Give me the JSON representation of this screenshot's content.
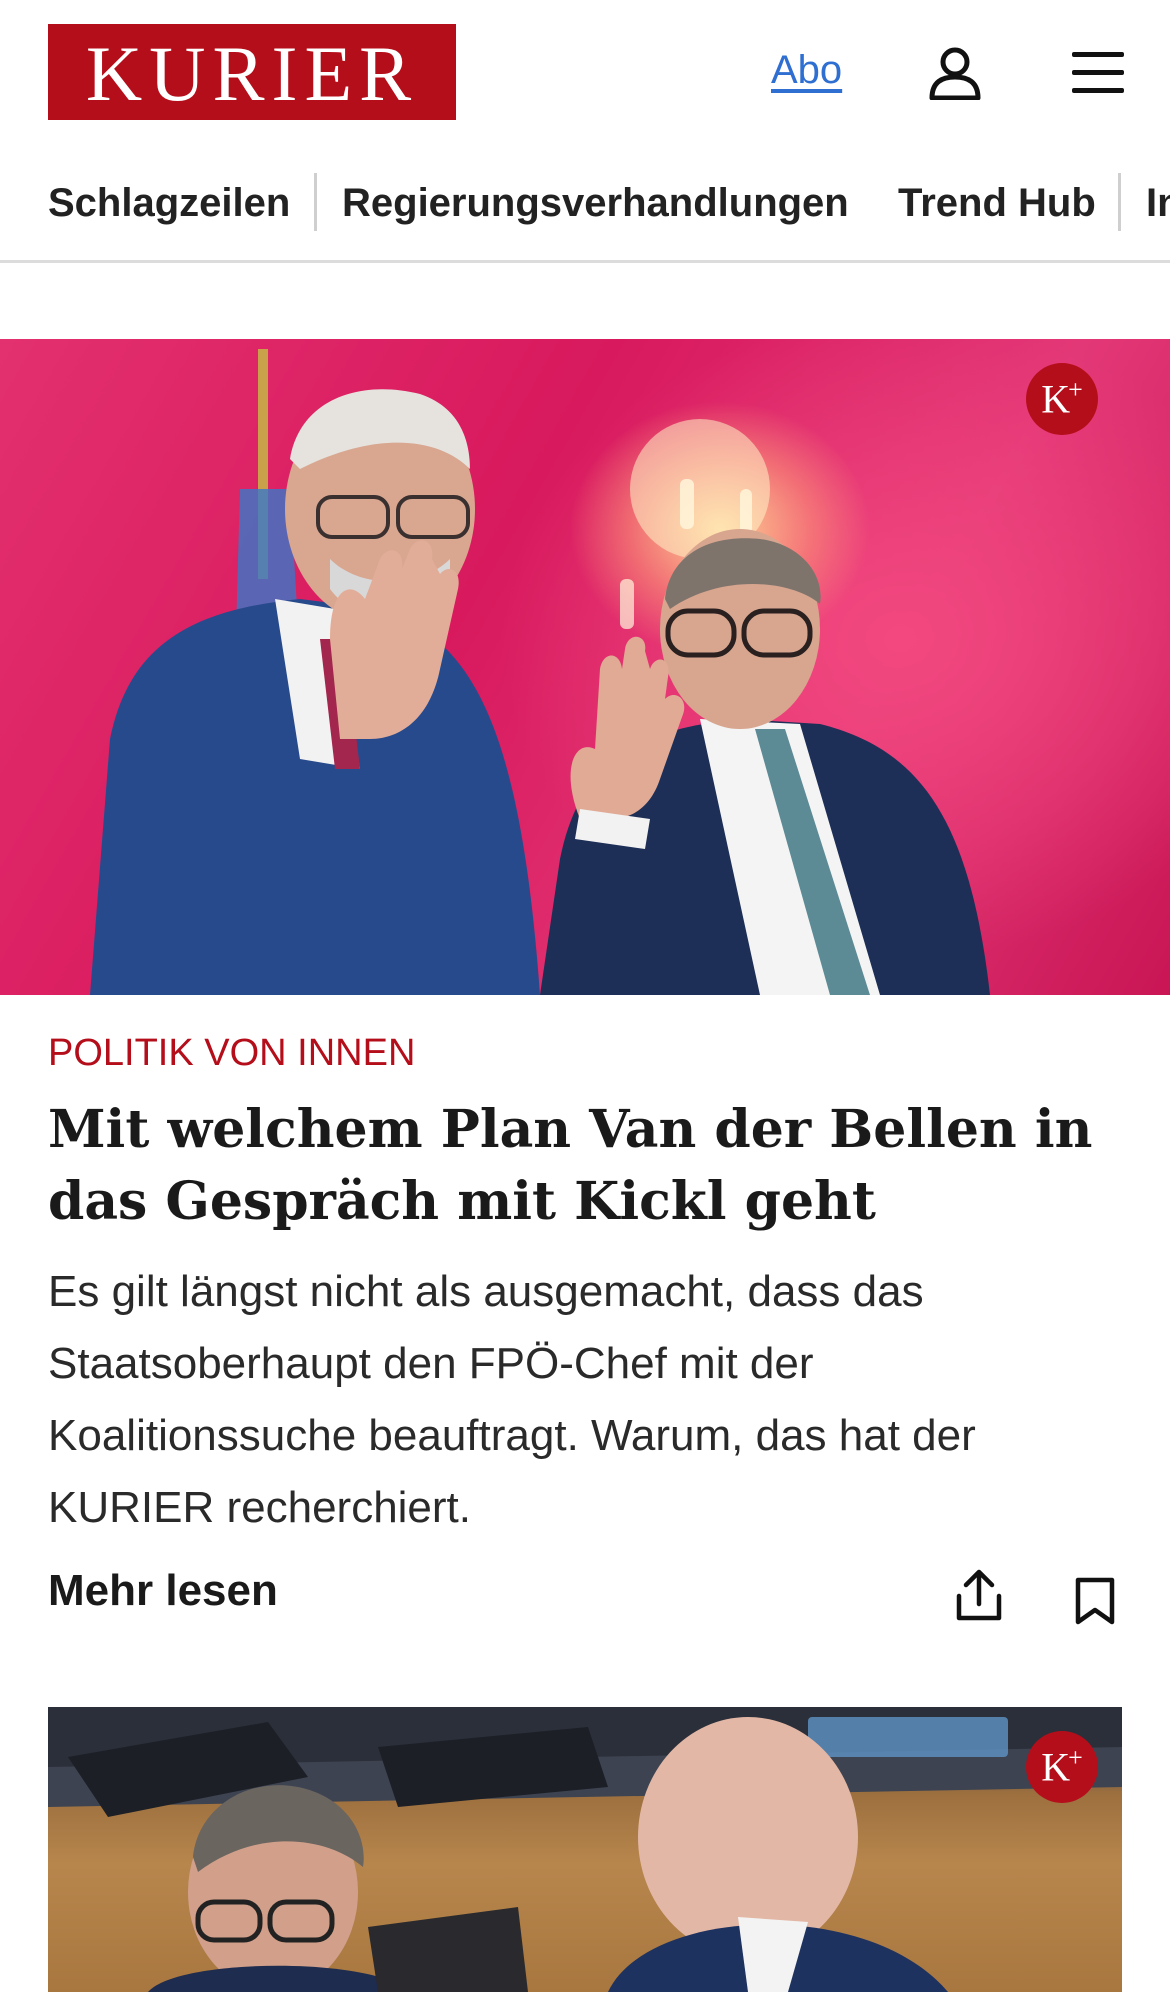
{
  "header": {
    "logo_text": "KURIER",
    "abo_label": "Abo",
    "user_icon": "user-icon",
    "menu_icon": "menu-icon"
  },
  "nav": {
    "items": [
      {
        "label": "Schlagzeilen"
      },
      {
        "label": "Regierungsverhandlungen"
      },
      {
        "label": "Trend Hub"
      },
      {
        "label": "In"
      }
    ]
  },
  "article1": {
    "badge": "K+",
    "kicker": "POLITIK VON INNEN",
    "headline": "Mit welchem Plan Van der Bellen in das Gespräch mit Kickl geht",
    "teaser": "Es gilt längst nicht als ausgemacht, dass das Staatsoberhaupt den FPÖ-Chef mit der Koalitionssuche beauftragt. Warum, das hat der KURIER recherchiert.",
    "more_label": "Mehr lesen",
    "share_icon": "share-icon",
    "bookmark_icon": "bookmark-icon"
  },
  "article2": {
    "badge": "K+"
  },
  "colors": {
    "brand": "#b50e1b",
    "link": "#2f6fd1"
  }
}
